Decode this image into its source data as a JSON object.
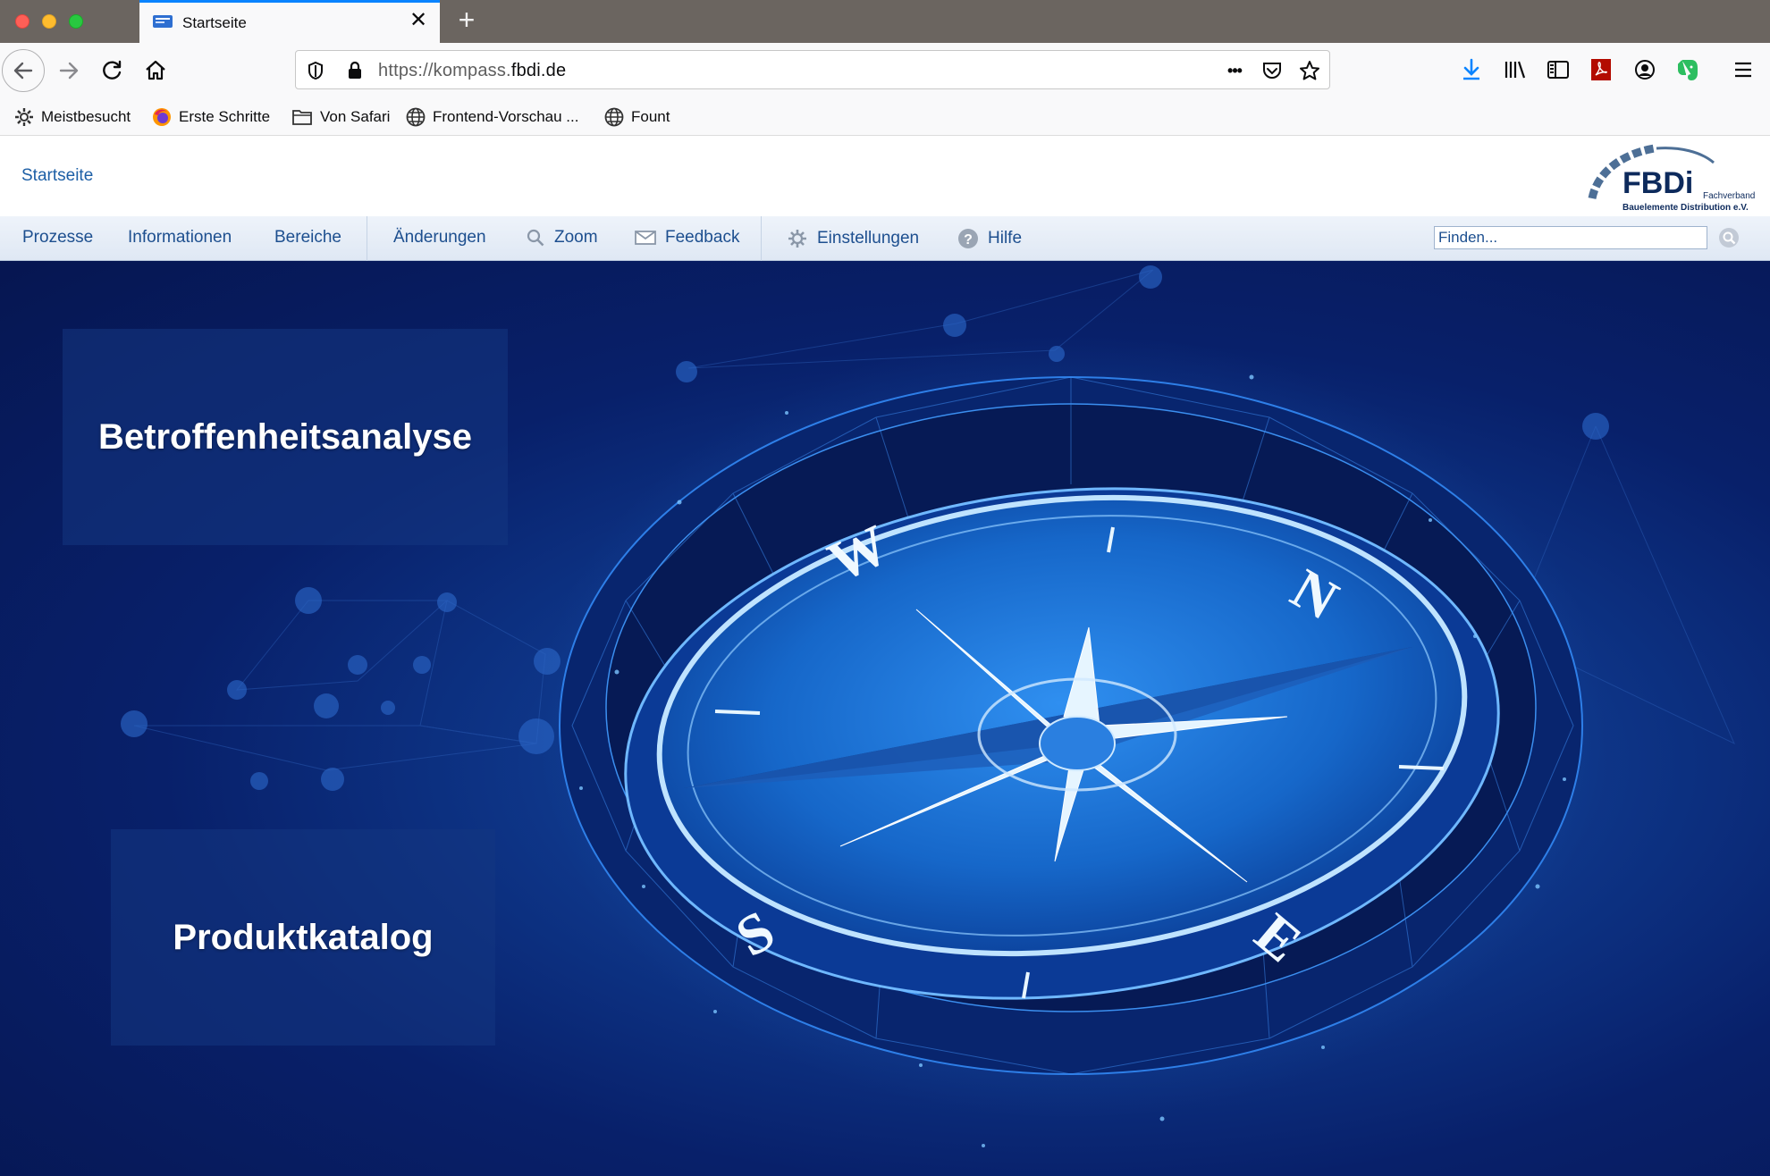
{
  "browser": {
    "tab_title": "Startseite",
    "new_tab_symbol": "+",
    "close_symbol": "✕",
    "url_prefix": "https://kompass.",
    "url_domain": "fbdi.de",
    "url_more": "•••",
    "bookmarks": [
      {
        "label": "Meistbesucht",
        "icon": "gear-icon"
      },
      {
        "label": "Erste Schritte",
        "icon": "firefox-icon"
      },
      {
        "label": "Von Safari",
        "icon": "folder-icon"
      },
      {
        "label": "Frontend-Vorschau ...",
        "icon": "globe-icon"
      },
      {
        "label": "Fount",
        "icon": "globe-icon"
      }
    ]
  },
  "site": {
    "breadcrumb": "Startseite",
    "logo": {
      "name": "FBDi",
      "line1": "Fachverband",
      "line2": "Bauelemente Distribution e.V."
    },
    "menu": [
      {
        "label": "Prozesse"
      },
      {
        "label": "Informationen"
      },
      {
        "label": "Bereiche"
      },
      {
        "label": "Änderungen"
      },
      {
        "label": "Zoom",
        "icon": "magnifier-icon"
      },
      {
        "label": "Feedback",
        "icon": "envelope-icon"
      },
      {
        "label": "Einstellungen",
        "icon": "gear-icon"
      },
      {
        "label": "Hilfe",
        "icon": "help-icon"
      }
    ],
    "search_placeholder": "Finden..."
  },
  "hero": {
    "cards": [
      {
        "label": "Betroffenheitsanalyse"
      },
      {
        "label": "Produktkatalog"
      }
    ],
    "compass_letters": [
      "W",
      "N",
      "E",
      "S"
    ]
  },
  "colors": {
    "accent": "#0a84ff",
    "menu_text": "#1d4f8f",
    "hero_dark": "#061651",
    "hero_light": "#1b5fc2"
  }
}
